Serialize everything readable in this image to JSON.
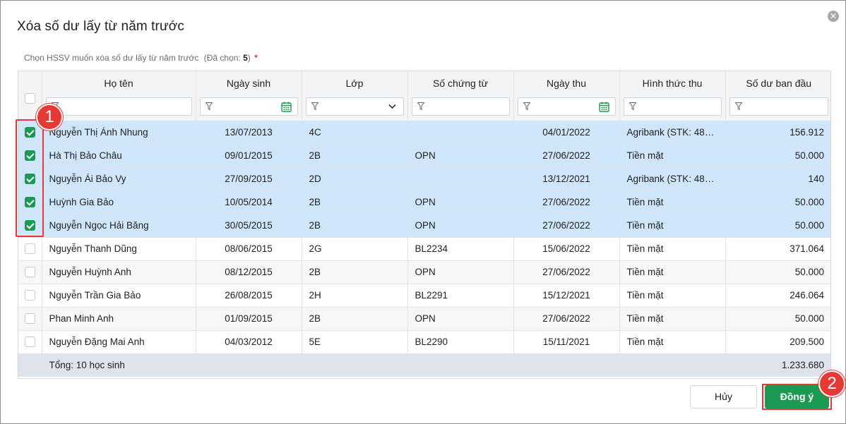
{
  "dialog": {
    "title": "Xóa số dư lấy từ năm trước",
    "close_icon": "close-icon",
    "subtitle": "Chọn HSSV muốn xóa số dư lấy từ năm trước",
    "selected_prefix": "(Đã chọn: ",
    "selected_count": "5",
    "selected_suffix": ")",
    "required_mark": "*"
  },
  "columns": [
    "Họ tên",
    "Ngày sinh",
    "Lớp",
    "Số chứng từ",
    "Ngày thu",
    "Hình thức thu",
    "Số dư ban đầu"
  ],
  "filters": {
    "ho_ten": "",
    "ngay_sinh": "",
    "lop": "",
    "so_chung_tu": "",
    "ngay_thu": "",
    "hinh_thuc_thu": "",
    "so_du": ""
  },
  "rows": [
    {
      "checked": true,
      "name": "Nguyễn Thị Ánh Nhung",
      "dob": "13/07/2013",
      "class": "4C",
      "doc": "",
      "date": "04/01/2022",
      "method": "Agribank (STK: 480...",
      "amount": "156.912"
    },
    {
      "checked": true,
      "name": "Hà Thị Bảo Châu",
      "dob": "09/01/2015",
      "class": "2B",
      "doc": "OPN",
      "date": "27/06/2022",
      "method": "Tiền mặt",
      "amount": "50.000"
    },
    {
      "checked": true,
      "name": "Nguyễn Ái Bảo Vy",
      "dob": "27/09/2015",
      "class": "2D",
      "doc": "",
      "date": "13/12/2021",
      "method": "Agribank (STK: 480...",
      "amount": "140"
    },
    {
      "checked": true,
      "name": "Huỳnh Gia Bảo",
      "dob": "10/05/2014",
      "class": "2B",
      "doc": "OPN",
      "date": "27/06/2022",
      "method": "Tiền mặt",
      "amount": "50.000"
    },
    {
      "checked": true,
      "name": "Nguyễn Ngọc Hải Băng",
      "dob": "30/05/2015",
      "class": "2B",
      "doc": "OPN",
      "date": "27/06/2022",
      "method": "Tiền mặt",
      "amount": "50.000"
    },
    {
      "checked": false,
      "name": "Nguyễn Thanh Dũng",
      "dob": "08/06/2015",
      "class": "2G",
      "doc": "BL2234",
      "date": "15/06/2022",
      "method": "Tiền mặt",
      "amount": "371.064"
    },
    {
      "checked": false,
      "name": "Nguyễn Huỳnh Anh",
      "dob": "08/12/2015",
      "class": "2B",
      "doc": "OPN",
      "date": "27/06/2022",
      "method": "Tiền mặt",
      "amount": "50.000"
    },
    {
      "checked": false,
      "name": "Nguyễn Trần Gia Bảo",
      "dob": "26/08/2015",
      "class": "2H",
      "doc": "BL2291",
      "date": "15/12/2021",
      "method": "Tiền mặt",
      "amount": "246.064"
    },
    {
      "checked": false,
      "name": "Phan Minh Anh",
      "dob": "01/09/2015",
      "class": "2B",
      "doc": "OPN",
      "date": "27/06/2022",
      "method": "Tiền mặt",
      "amount": "50.000"
    },
    {
      "checked": false,
      "name": "Nguyễn Đặng Mai Anh",
      "dob": "04/03/2012",
      "class": "5E",
      "doc": "BL2290",
      "date": "15/11/2021",
      "method": "Tiền mặt",
      "amount": "209.500"
    }
  ],
  "footer": {
    "total_label": "Tổng: 10 học sinh",
    "total_amount": "1.233.680"
  },
  "annotations": {
    "step1": "1",
    "step2": "2"
  },
  "buttons": {
    "cancel": "Hủy",
    "ok": "Đồng ý"
  },
  "colors": {
    "accent_green": "#1a9a52",
    "selected_row": "#cfe6fb",
    "annotation_red": "#e53935"
  }
}
